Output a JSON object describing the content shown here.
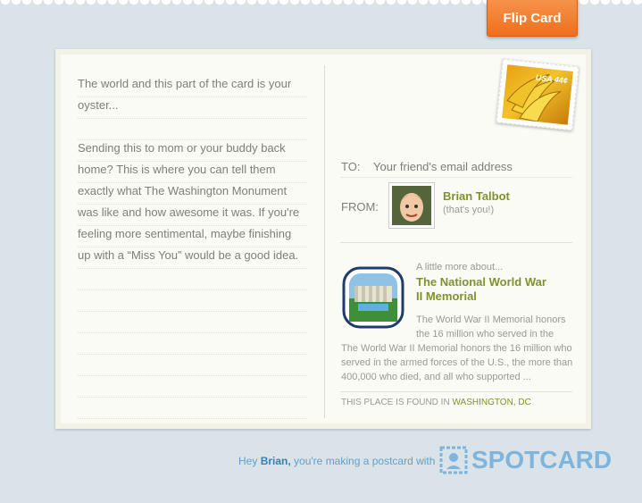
{
  "header": {
    "flip_button_label": "Flip Card"
  },
  "message": {
    "paragraph_1": "The world and this part of the card is your oyster...",
    "paragraph_2": "Sending this to mom or your buddy back home? This is where you can tell them exactly what The Washington Monument was like and how awesome it was. If you're feeling more sentimental, maybe finishing up with a “Miss You” would be a good idea."
  },
  "stamp": {
    "text": "USA 44¢",
    "icon": "banana-stamp-icon"
  },
  "address": {
    "to_label": "TO:",
    "to_placeholder": "Your friend's email address",
    "from_label": "FROM:",
    "from_name": "Brian Talbot",
    "from_note": "(that's you!)"
  },
  "about": {
    "kicker": "A little more about...",
    "title": "The National World War II Memorial",
    "desc_a": "The World War II Memorial honors the 16 million who served in the",
    "desc_b": "The World War II Memorial honors the 16 million who served in the armed forces of the U.S., the more than 400,000 who died, and all who supported ...",
    "place_prefix": "THIS PLACE IS FOUND IN",
    "place_location": "WASHINGTON, DC"
  },
  "footer": {
    "hey": "Hey",
    "name": "Brian,",
    "text": "you're making a postcard with",
    "logo_text": "SPOTCARD"
  },
  "colors": {
    "accent_orange": "#ee6f1e",
    "olive": "#809030",
    "link_blue": "#62a0c8",
    "background": "#d9e3e8"
  }
}
